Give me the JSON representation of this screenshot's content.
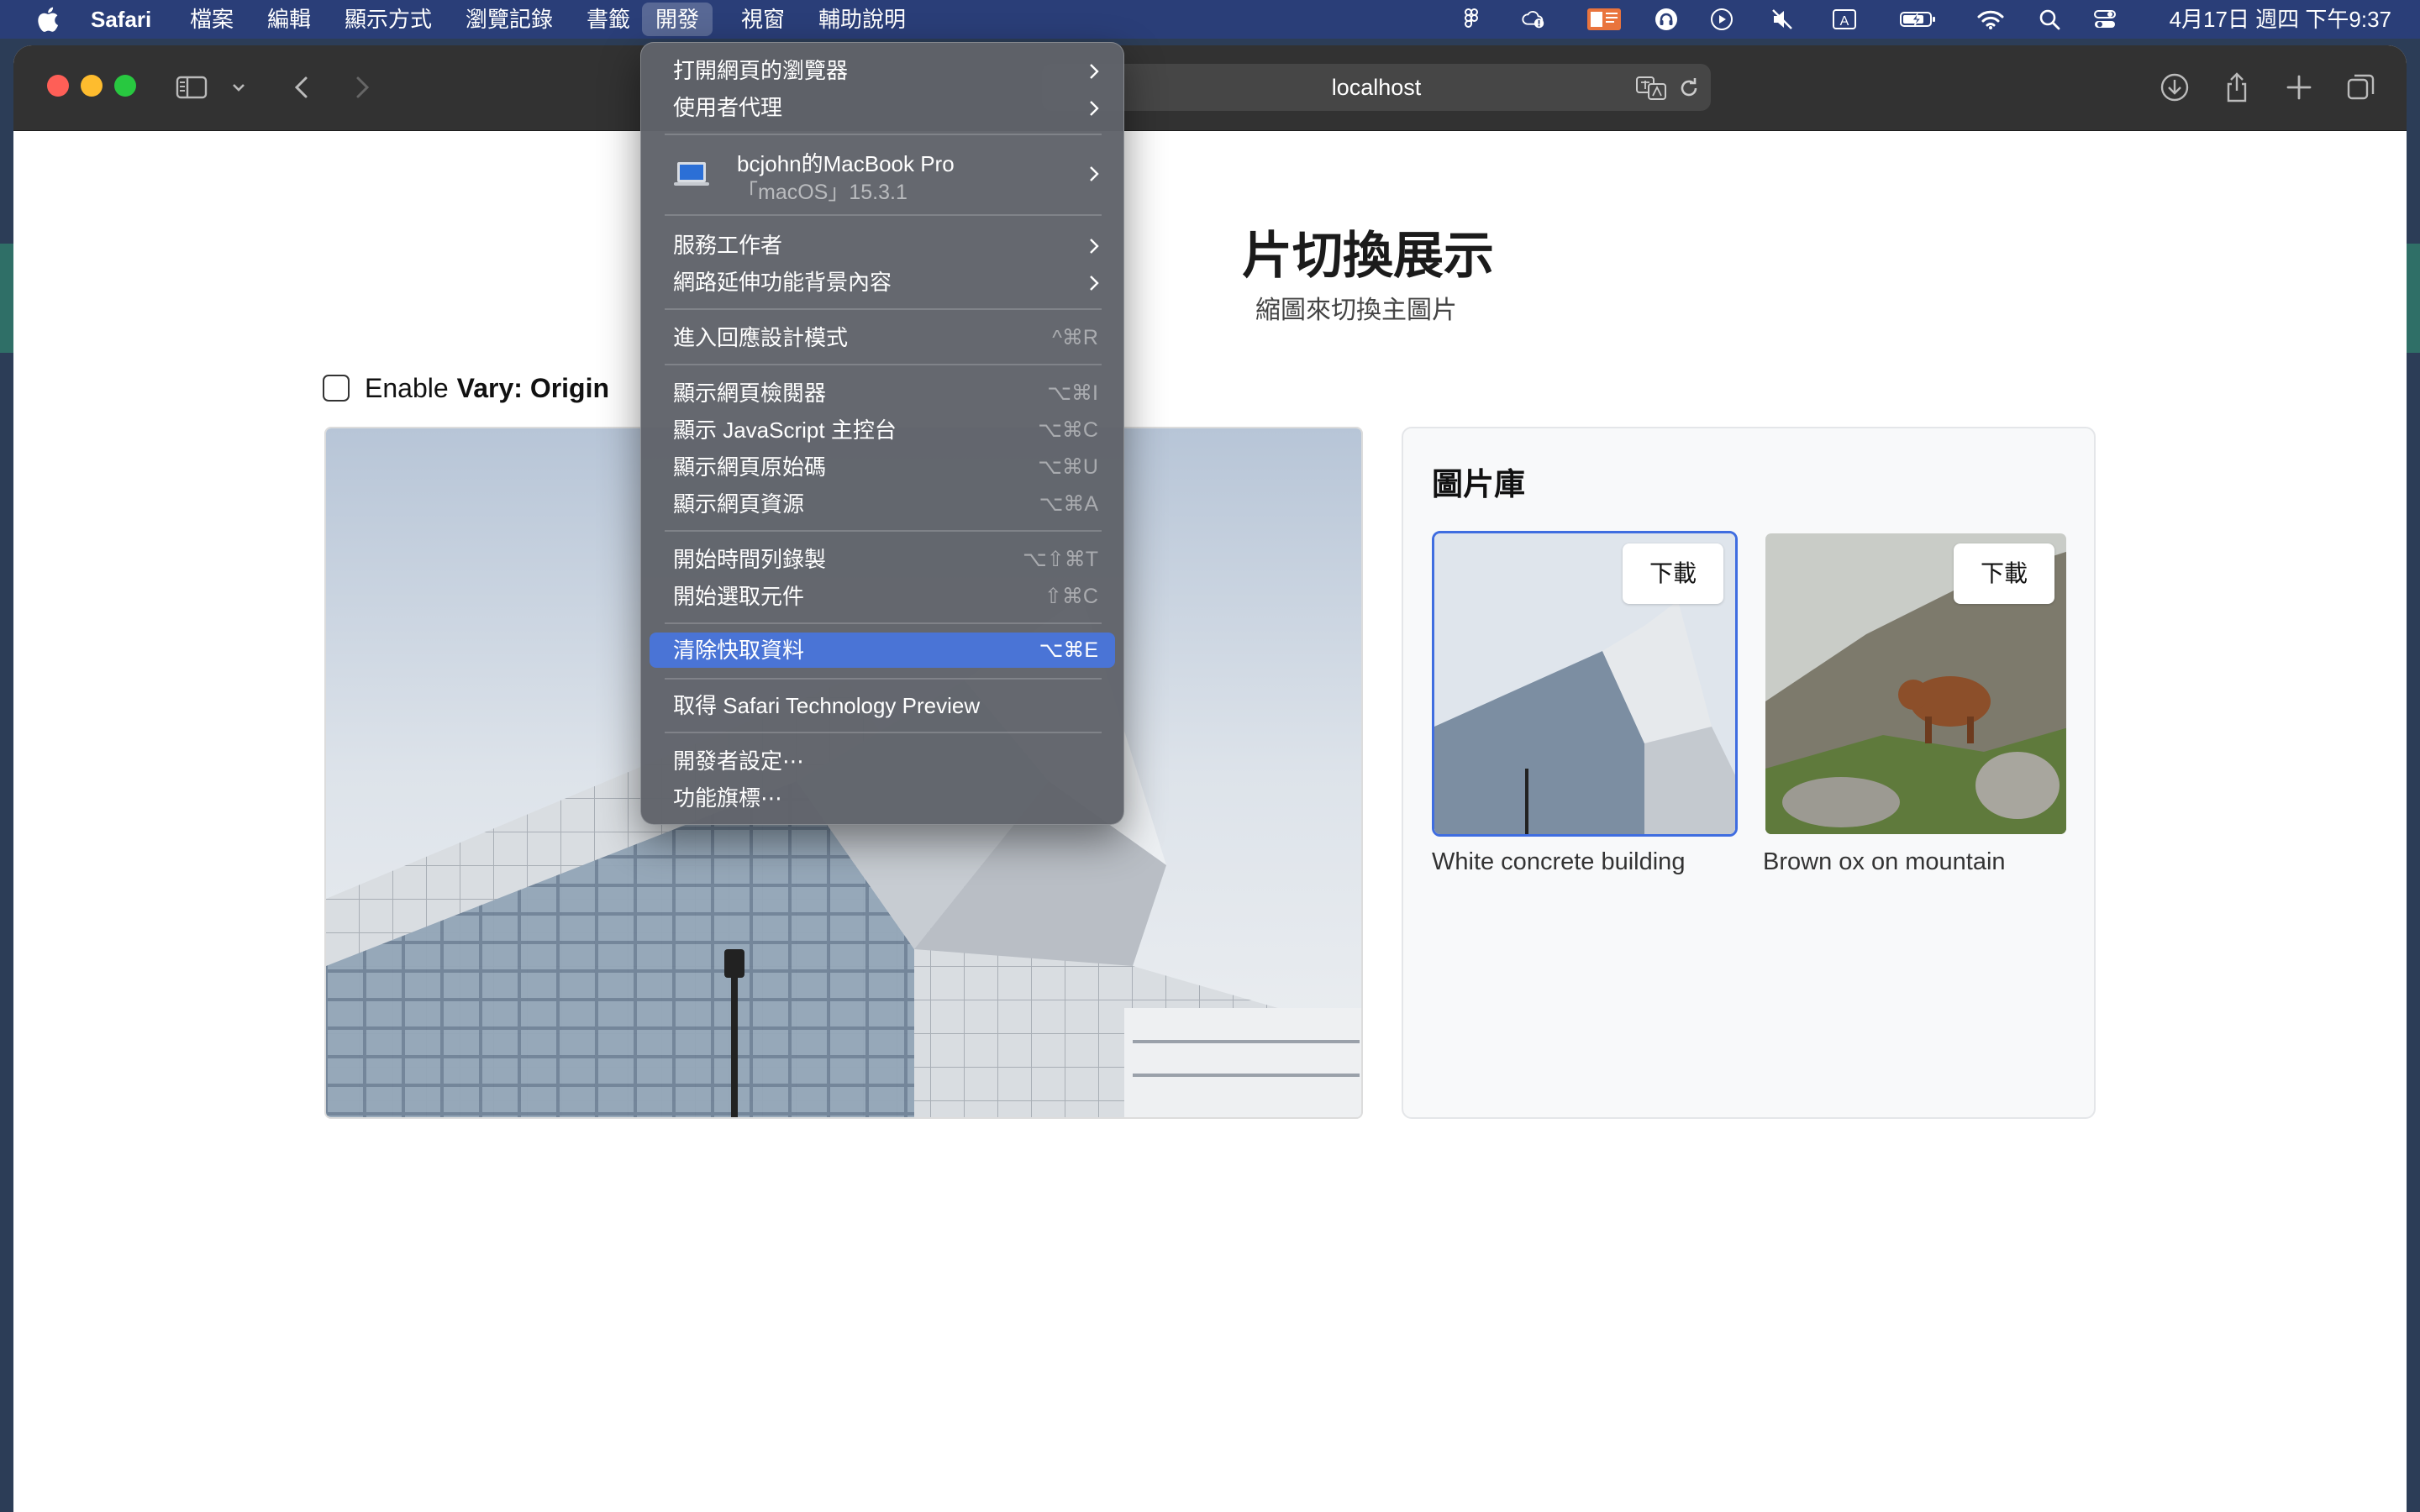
{
  "menubar": {
    "app_name": "Safari",
    "menus": [
      "檔案",
      "編輯",
      "顯示方式",
      "瀏覽記錄",
      "書籤",
      "開發",
      "視窗",
      "輔助說明"
    ],
    "active_menu": "開發",
    "clock": "4月17日 週四 下午9:37",
    "status_icons": [
      "figma-icon",
      "weather-alert-icon",
      "input-method-icon",
      "headphones-icon",
      "play-icon",
      "mute-icon",
      "keyboard-a-icon",
      "battery-charging-icon",
      "wifi-icon",
      "spotlight-search-icon",
      "control-center-icon"
    ]
  },
  "browser": {
    "url": "localhost"
  },
  "page": {
    "title": "圖片切換展示",
    "title_visible": "片切換展示",
    "subtitle_visible": "縮圖來切換主圖片",
    "vary_label_prefix": "Enable",
    "vary_label_bold": "Vary: Origin",
    "vary_checked": false,
    "gallery": {
      "title": "圖片庫",
      "items": [
        {
          "caption": "White concrete building",
          "download_label": "下載",
          "selected": true
        },
        {
          "caption": "Brown ox on mountain",
          "download_label": "下載",
          "selected": false
        }
      ]
    }
  },
  "develop_menu": {
    "items": [
      {
        "label": "打開網頁的瀏覽器",
        "submenu": true
      },
      {
        "label": "使用者代理",
        "submenu": true
      },
      {
        "device_name": "bcjohn的MacBook Pro",
        "device_os": "「macOS」15.3.1",
        "submenu": true
      },
      {
        "label": "服務工作者",
        "submenu": true
      },
      {
        "label": "網路延伸功能背景內容",
        "submenu": true
      },
      {
        "label": "進入回應設計模式",
        "shortcut": "^⌘R"
      },
      {
        "label": "顯示網頁檢閱器",
        "shortcut": "⌥⌘I"
      },
      {
        "label": "顯示 JavaScript 主控台",
        "shortcut": "⌥⌘C"
      },
      {
        "label": "顯示網頁原始碼",
        "shortcut": "⌥⌘U"
      },
      {
        "label": "顯示網頁資源",
        "shortcut": "⌥⌘A"
      },
      {
        "label": "開始時間列錄製",
        "shortcut": "⌥⇧⌘T"
      },
      {
        "label": "開始選取元件",
        "shortcut": "⇧⌘C"
      },
      {
        "label": "清除快取資料",
        "shortcut": "⌥⌘E",
        "highlighted": true
      },
      {
        "label": "取得 Safari Technology Preview"
      },
      {
        "label": "開發者設定⋯"
      },
      {
        "label": "功能旗標⋯"
      }
    ]
  },
  "colors": {
    "menu_highlight": "#4a74d6",
    "thumb_selected_border": "#3f6de0",
    "toolbar": "#323232"
  }
}
